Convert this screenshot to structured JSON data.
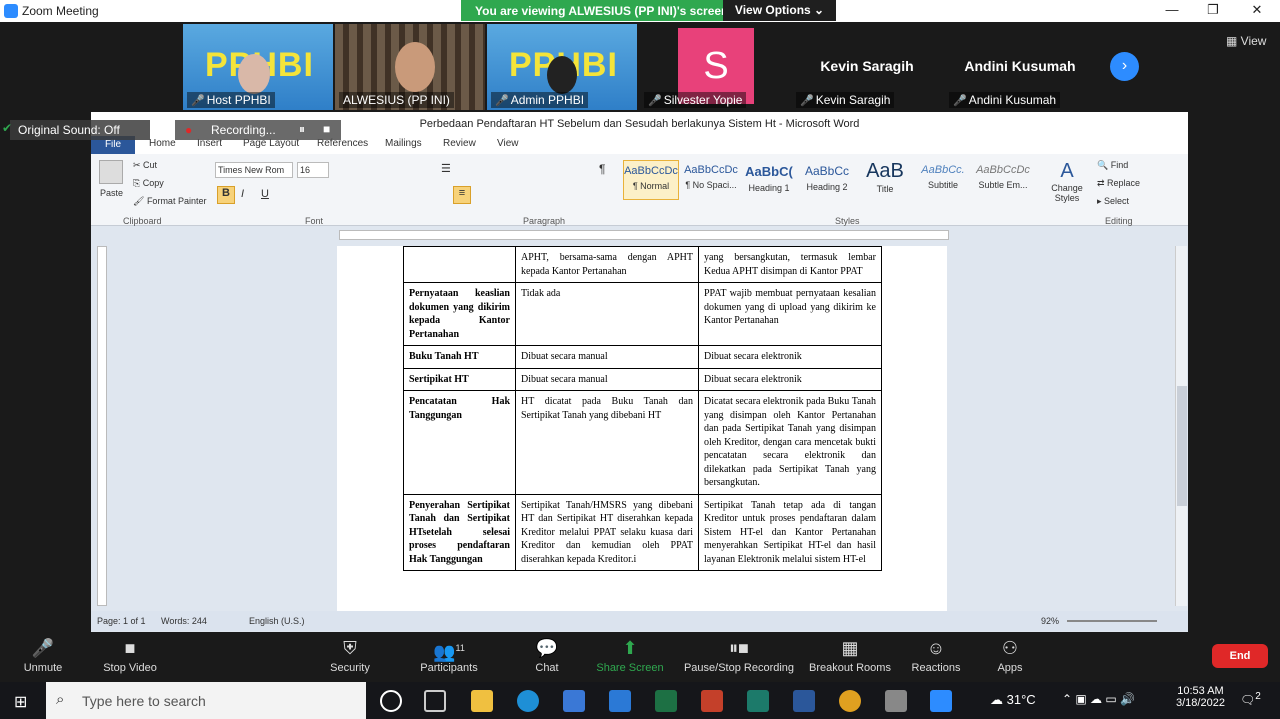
{
  "window": {
    "title": "Zoom Meeting"
  },
  "banner": {
    "viewing": "You are viewing ALWESIUS (PP INI)'s screen",
    "view_options": "View Options"
  },
  "gallery": {
    "view_label": "View",
    "tiles": [
      {
        "name": "Host PPHBI",
        "logo": "PPHBI"
      },
      {
        "name": "ALWESIUS (PP INI)"
      },
      {
        "name": "Admin PPHBI",
        "logo": "PPHBI"
      },
      {
        "name": "Silvester Yopie",
        "initial": "S"
      },
      {
        "name": "Kevin Saragih",
        "display": "Kevin Saragih"
      },
      {
        "name": "Andini Kusumah",
        "display": "Andini Kusumah"
      }
    ]
  },
  "overlay": {
    "sound": "Original Sound: Off",
    "recording": "Recording..."
  },
  "word": {
    "title": "Perbedaan Pendaftaran HT Sebelum dan Sesudah berlakunya Sistem Ht - Microsoft Word",
    "tabs": [
      "File",
      "Home",
      "Insert",
      "Page Layout",
      "References",
      "Mailings",
      "Review",
      "View"
    ],
    "clipboard": {
      "paste": "Paste",
      "cut": "Cut",
      "copy": "Copy",
      "format_painter": "Format Painter",
      "group": "Clipboard"
    },
    "font": {
      "name": "Times New Rom",
      "size": "16",
      "group": "Font"
    },
    "paragraph": {
      "group": "Paragraph"
    },
    "styles": {
      "group": "Styles",
      "items": [
        {
          "sample": "AaBbCcDc",
          "label": "¶ Normal"
        },
        {
          "sample": "AaBbCcDc",
          "label": "¶ No Spaci..."
        },
        {
          "sample": "AaBbC(",
          "label": "Heading 1"
        },
        {
          "sample": "AaBbCc",
          "label": "Heading 2"
        },
        {
          "sample": "AaB",
          "label": "Title"
        },
        {
          "sample": "AaBbCc.",
          "label": "Subtitle"
        },
        {
          "sample": "AaBbCcDc",
          "label": "Subtle Em..."
        }
      ],
      "change": "Change Styles"
    },
    "editing": {
      "find": "Find",
      "replace": "Replace",
      "select": "Select",
      "group": "Editing"
    },
    "table": [
      [
        "",
        "APHT, bersama-sama dengan APHT kepada Kantor Pertanahan",
        "yang bersangkutan, termasuk lembar Kedua APHT disimpan di Kantor PPAT"
      ],
      [
        "Pernyataan keaslian dokumen yang dikirim kepada Kantor Pertanahan",
        "Tidak ada",
        "PPAT wajib membuat pernyataan kesalian dokumen yang di upload yang dikirim ke Kantor Pertanahan"
      ],
      [
        "Buku Tanah HT",
        "Dibuat secara manual",
        "Dibuat secara elektronik"
      ],
      [
        "Sertipikat HT",
        "Dibuat secara manual",
        "Dibuat secara elektronik"
      ],
      [
        "Pencatatan Hak Tanggungan",
        "HT dicatat pada Buku Tanah dan Sertipikat Tanah yang dibebani HT",
        "Dicatat secara elektronik pada Buku Tanah yang disimpan oleh Kantor Pertanahan dan pada Sertipikat Tanah yang disimpan oleh Kreditor, dengan cara mencetak bukti pencatatan secara elektronik dan dilekatkan pada Sertipikat Tanah yang bersangkutan."
      ],
      [
        "Penyerahan Sertipikat Tanah dan Sertipikat HTsetelah selesai proses pendaftaran Hak Tanggungan",
        "Sertipikat Tanah/HMSRS yang dibebani HT dan Sertipikat HT diserahkan kepada Kreditor melalui PPAT selaku kuasa dari Kreditor dan kemudian oleh PPAT diserahkan kepada Kreditor.i",
        "Sertipikat Tanah tetap ada di tangan Kreditor untuk proses pendaftaran dalam Sistem HT-el dan Kantor Pertanahan menyerahkan Sertipikat HT-el dan hasil layanan Elektronik melalui sistem HT-el"
      ]
    ],
    "status": {
      "page": "Page: 1 of 1",
      "words": "Words: 244",
      "lang": "English (U.S.)",
      "zoom": "92%"
    }
  },
  "toolbar": {
    "unmute": "Unmute",
    "stop_video": "Stop Video",
    "security": "Security",
    "participants": "Participants",
    "participants_count": "11",
    "chat": "Chat",
    "share": "Share Screen",
    "pause_rec": "Pause/Stop Recording",
    "breakout": "Breakout Rooms",
    "reactions": "Reactions",
    "apps": "Apps",
    "end": "End"
  },
  "taskbar": {
    "search_placeholder": "Type here to search",
    "temp": "31°C",
    "time": "10:53 AM",
    "date": "3/18/2022",
    "notif": "2"
  },
  "colors": {
    "zoom_green": "#2fa84f",
    "end_red": "#e02828",
    "zoom_blue": "#2d8cff"
  }
}
